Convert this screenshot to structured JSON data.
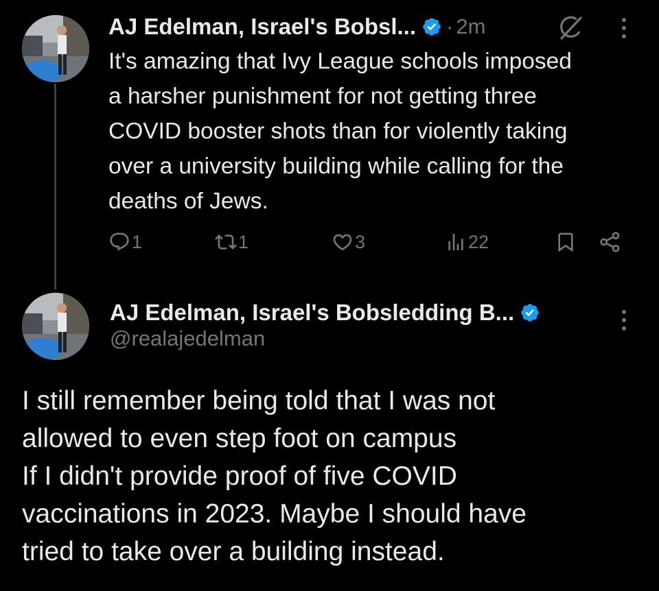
{
  "colors": {
    "background": "#000000",
    "text_primary": "#e7e9ea",
    "text_secondary": "#71767b",
    "verified_blue": "#1d9bf0",
    "thread_line": "#3e4144"
  },
  "parent_tweet": {
    "display_name": "AJ Edelman, Israel's Bobsl...",
    "verified_icon": "verified-badge-icon",
    "separator": "·",
    "timestamp": "2m",
    "text": "It's amazing that Ivy League schools imposed\na harsher punishment for not getting three\nCOVID booster shots than for violently taking\nover a university building while calling for the\ndeaths of Jews.",
    "actions": {
      "replies": "1",
      "reposts": "1",
      "likes": "3",
      "views": "22"
    }
  },
  "main_tweet": {
    "display_name": "AJ Edelman, Israel's Bobsledding B...",
    "handle": "@realajedelman",
    "text": "I still remember being told that I was not\nallowed to even step foot on campus\nIf I didn't provide proof of five COVID\nvaccinations in 2023. Maybe I should have\ntried to take over a building instead."
  },
  "icons": {
    "grok": "grok-icon",
    "more": "more-vertical-icon",
    "reply": "reply-icon",
    "repost": "repost-icon",
    "like": "heart-icon",
    "views": "views-icon",
    "bookmark": "bookmark-icon",
    "share": "share-icon"
  }
}
